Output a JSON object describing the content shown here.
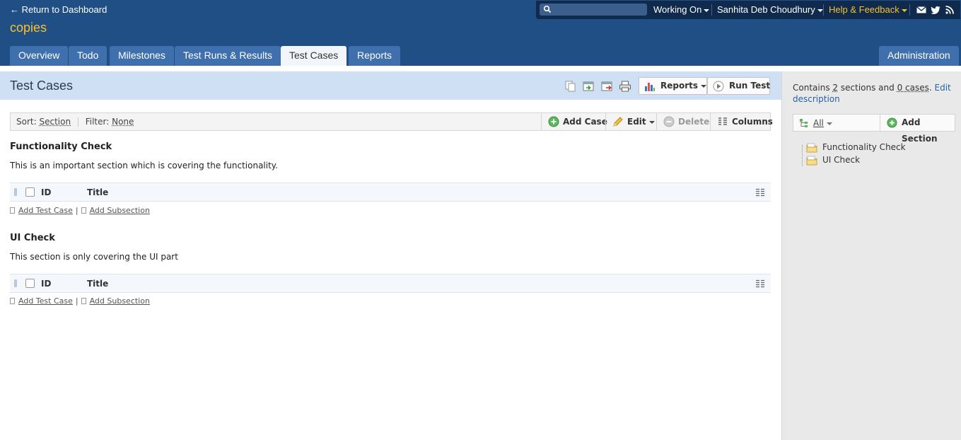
{
  "header": {
    "return_link": "← Return to Dashboard",
    "project_name": "copies",
    "search": {
      "placeholder": "",
      "value": ""
    },
    "working_on": "Working On",
    "user_name": "Sanhita Deb Choudhury",
    "help": "Help & Feedback",
    "accent_color": "#f7c230",
    "bg_color": "#1f4f85"
  },
  "tabs": [
    {
      "label": "Overview"
    },
    {
      "label": "Todo"
    },
    {
      "label": "Milestones"
    },
    {
      "label": "Test Runs & Results"
    },
    {
      "label": "Test Cases"
    },
    {
      "label": "Reports"
    },
    {
      "label": "Administration"
    }
  ],
  "page": {
    "title": "Test Cases",
    "reports_button": "Reports",
    "run_test_button": "Run Test"
  },
  "toolbar": {
    "sort_label": "Sort:",
    "sort_value": "Section",
    "filter_label": "Filter:",
    "filter_value": "None",
    "add_case": "Add Case",
    "edit": "Edit",
    "delete": "Delete",
    "columns": "Columns"
  },
  "sections": [
    {
      "title": "Functionality Check",
      "description": "This is an important section which is covering the functionality.",
      "col_id": "ID",
      "col_title": "Title",
      "add_test_case": "Add Test Case",
      "add_subsection": "Add Subsection"
    },
    {
      "title": "UI Check",
      "description": "This section is only covering the UI part",
      "col_id": "ID",
      "col_title": "Title",
      "add_test_case": "Add Test Case",
      "add_subsection": "Add Subsection"
    }
  ],
  "sidebar": {
    "contains": "Contains",
    "section_count": "2",
    "sections_and": "sections and",
    "case_count": "0 cases",
    "edit_description": "Edit description",
    "filter_all": "All",
    "add_section": "Add Section",
    "tree": [
      {
        "label": "Functionality Check"
      },
      {
        "label": "UI Check"
      }
    ]
  }
}
